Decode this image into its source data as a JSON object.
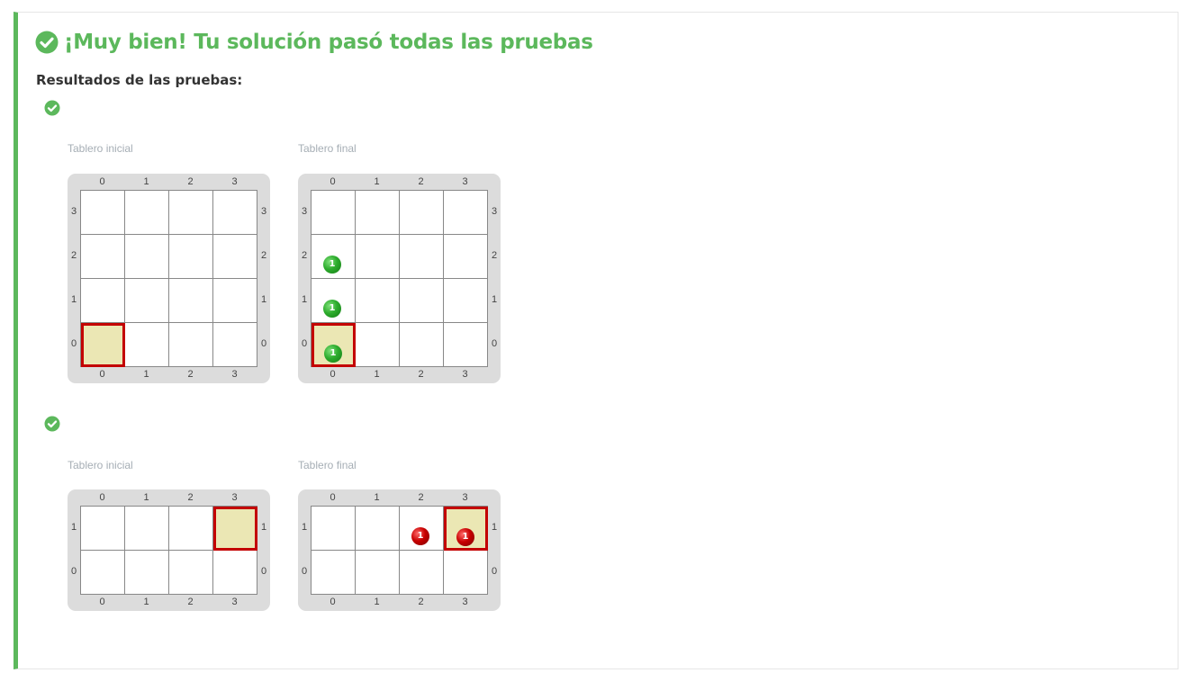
{
  "header": {
    "title": "¡Muy bien! Tu solución pasó todas las pruebas",
    "subtitle": "Resultados de las pruebas:"
  },
  "colors": {
    "success": "#5cb85c",
    "head_border": "#c30000",
    "head_fill": "#ebe7b4",
    "ball_green": "#2dac2d",
    "ball_red": "#c80000"
  },
  "tests": [
    {
      "status": "passed",
      "initial_label": "Tablero inicial",
      "final_label": "Tablero final",
      "cols": 4,
      "rows": 4,
      "initial": {
        "head": [
          0,
          0
        ],
        "balls": []
      },
      "final": {
        "head": [
          0,
          0
        ],
        "balls": [
          {
            "col": 0,
            "row": 2,
            "color": "green",
            "count": "1"
          },
          {
            "col": 0,
            "row": 1,
            "color": "green",
            "count": "1"
          },
          {
            "col": 0,
            "row": 0,
            "color": "green",
            "count": "1"
          }
        ]
      }
    },
    {
      "status": "passed",
      "initial_label": "Tablero inicial",
      "final_label": "Tablero final",
      "cols": 4,
      "rows": 2,
      "initial": {
        "head": [
          3,
          1
        ],
        "balls": []
      },
      "final": {
        "head": [
          3,
          1
        ],
        "balls": [
          {
            "col": 2,
            "row": 1,
            "color": "red",
            "count": "1"
          },
          {
            "col": 3,
            "row": 1,
            "color": "red",
            "count": "1"
          }
        ]
      }
    }
  ]
}
